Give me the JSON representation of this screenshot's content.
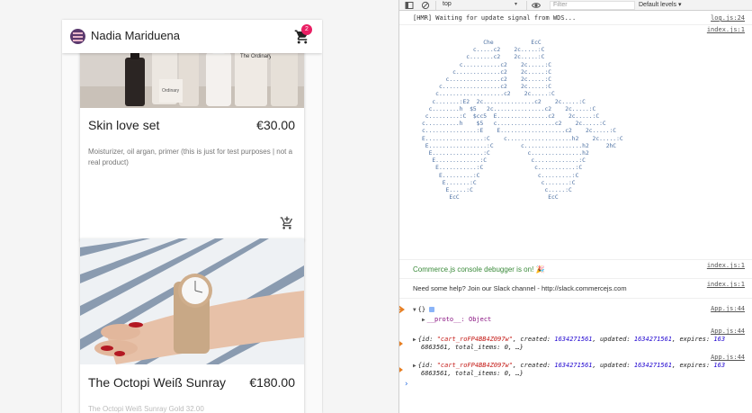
{
  "app": {
    "store_name": "Nadia Mariduena",
    "cart_count": "2",
    "products": [
      {
        "name": "Skin love set",
        "price": "€30.00",
        "description": "Moisturizer, oil argan, primer (this is just for test purposes | not a real product)"
      },
      {
        "name": "The Octopi Weiß Sunray",
        "price": "€180.00",
        "description": "The Octopi Weiß Sunray Gold 32.00"
      }
    ],
    "image_labels": {
      "bottle_a": "Ordinary",
      "bottle_b": "The Ordinary."
    }
  },
  "devtools": {
    "context": "top",
    "filter_placeholder": "Filter",
    "levels": "Default levels ▾",
    "logs": [
      {
        "text": "[HMR] Waiting for update signal from WDS...",
        "source": "log.js:24"
      },
      {
        "text": "",
        "source": "index.js:1"
      },
      {
        "text": "Commerce.js console debugger is on! 🎉",
        "source": "index.js:1"
      },
      {
        "text": "Need some help? Join our Slack channel - http://slack.commercejs.com",
        "source": "index.js:1"
      },
      {
        "text": "{} ",
        "source": "App.js:44"
      },
      {
        "text": "__proto__: Object",
        "source": ""
      },
      {
        "text_parts": [
          "{id: ",
          "\"cart_roFP4BB4Z097w\"",
          ", created: ",
          "1634271561",
          ", updated: ",
          "1634271561",
          ", expires: ",
          "163"
        ],
        "continuation": "6863561, total_items: 0, …}",
        "source": "App.js:44"
      },
      {
        "text_parts": [
          "{id: ",
          "\"cart_roFP4BB4Z097w\"",
          ", created: ",
          "1634271561",
          ", updated: ",
          "1634271561",
          ", expires: ",
          "163"
        ],
        "continuation": "6863561, total_items: 0, …}",
        "source": "App.js:44"
      }
    ],
    "ascii_art": "                  Che           EcC\n               c.....c2    2c.....:C\n             c.......c2    2c.....:C\n           c...........c2    2c.....:C\n         c.............c2    2c.....:C\n       c...............c2    2c.....:C\n     c.................c2    2c.....:C\n    c...................c2    2c.....:C\n   c.......:E2  2c...............c2    2c.....:C\n  c........h  $5   2c...............c2    2c.....:C\n c.........:C  $cc5  E...............c2    2c.....:C\nc..........h    $5   c.................c2    2c.....:C\nc...............:E    E...................c2    2c.....:C\nE.................:C    c...................h2    2c.....:C\n E.................:C        c.................h2     2hC\n  E...............:C           c...............h2\n   E.............:C             c.............:C\n    E...........:C               c...........:C\n     E.........:C                 c.........:C\n      E.......:C                   c.......:C\n       E.....:C                     c.....:C\n        EcC                          EcC",
    "prompt_symbol": "›"
  },
  "colors": {
    "badge": "#e91e63",
    "console_green": "#3a8a3a",
    "annotation_arrow": "#e67e22"
  }
}
